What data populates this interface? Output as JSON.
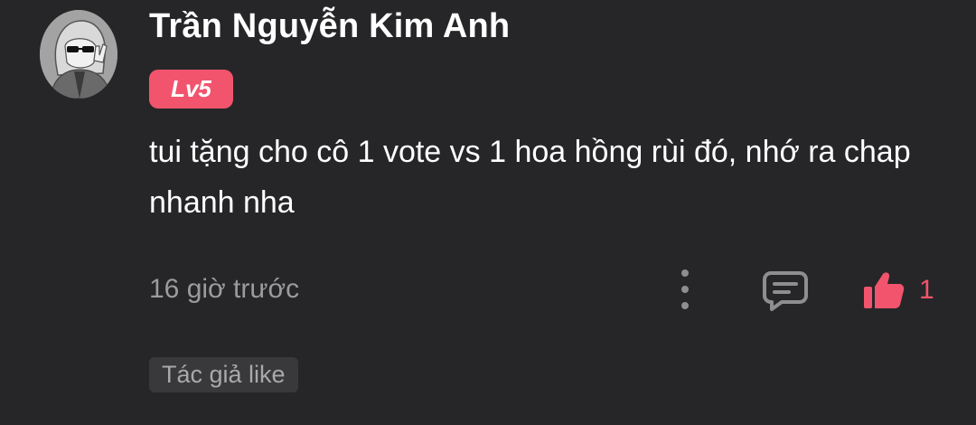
{
  "comment": {
    "author_name": "Trần Nguyễn Kim Anh",
    "level_badge": "Lv5",
    "text": "tui tặng cho cô 1 vote vs 1 hoa hồng rùi đó, nhớ ra chap nhanh nha",
    "time_ago": "16 giờ trước",
    "like_count": "1",
    "author_liked_label": "Tác giả like"
  },
  "icons": {
    "avatar": "avatar-image",
    "more": "more-vertical-icon",
    "reply": "comment-icon",
    "like": "thumbs-up-icon"
  },
  "colors": {
    "background": "#262628",
    "accent": "#f2546d",
    "secondary_text": "#9b9b9d",
    "tag_background": "#39393b"
  }
}
